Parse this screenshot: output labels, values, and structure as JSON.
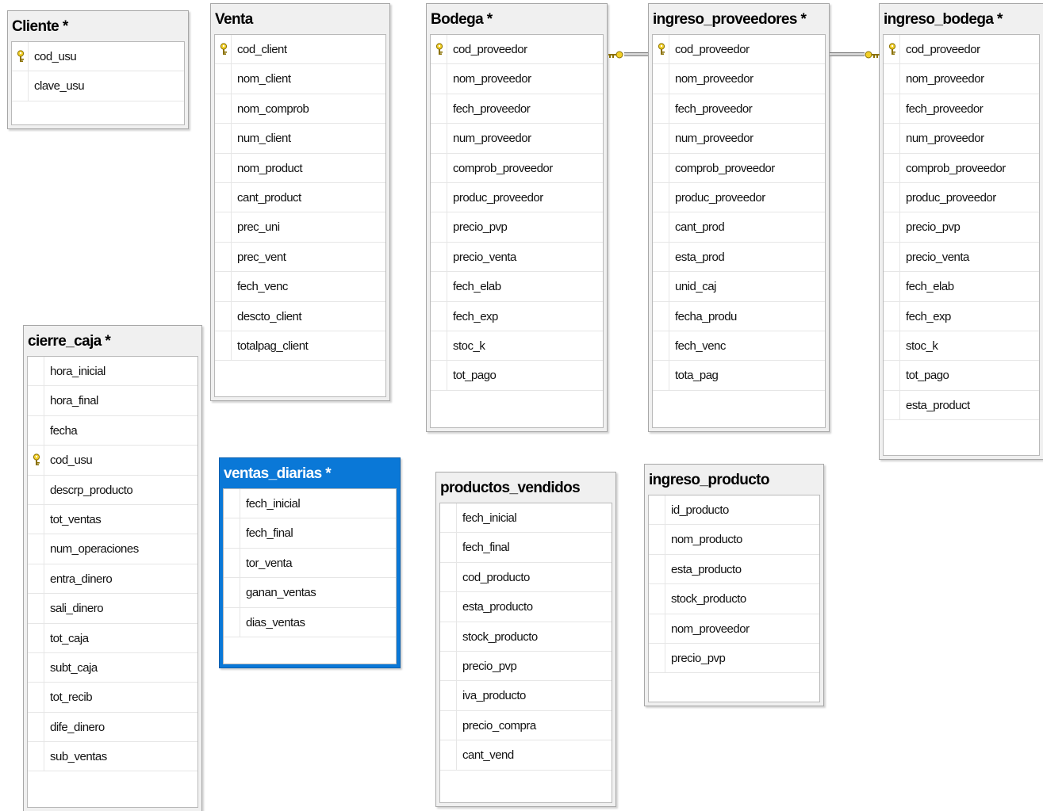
{
  "tables": {
    "cliente": {
      "title": "Cliente *",
      "columns": [
        {
          "name": "cod_usu",
          "pk": true
        },
        {
          "name": "clave_usu",
          "pk": false
        }
      ]
    },
    "venta": {
      "title": "Venta",
      "columns": [
        {
          "name": "cod_client",
          "pk": true
        },
        {
          "name": "nom_client",
          "pk": false
        },
        {
          "name": "nom_comprob",
          "pk": false
        },
        {
          "name": "num_client",
          "pk": false
        },
        {
          "name": "nom_product",
          "pk": false
        },
        {
          "name": "cant_product",
          "pk": false
        },
        {
          "name": "prec_uni",
          "pk": false
        },
        {
          "name": "prec_vent",
          "pk": false
        },
        {
          "name": "fech_venc",
          "pk": false
        },
        {
          "name": "descto_client",
          "pk": false
        },
        {
          "name": "totalpag_client",
          "pk": false
        }
      ]
    },
    "bodega": {
      "title": "Bodega *",
      "columns": [
        {
          "name": "cod_proveedor",
          "pk": true
        },
        {
          "name": "nom_proveedor",
          "pk": false
        },
        {
          "name": "fech_proveedor",
          "pk": false
        },
        {
          "name": "num_proveedor",
          "pk": false
        },
        {
          "name": "comprob_proveedor",
          "pk": false
        },
        {
          "name": "produc_proveedor",
          "pk": false
        },
        {
          "name": "precio_pvp",
          "pk": false
        },
        {
          "name": "precio_venta",
          "pk": false
        },
        {
          "name": "fech_elab",
          "pk": false
        },
        {
          "name": "fech_exp",
          "pk": false
        },
        {
          "name": "stoc_k",
          "pk": false
        },
        {
          "name": "tot_pago",
          "pk": false
        }
      ]
    },
    "ingreso_proveedores": {
      "title": "ingreso_proveedores *",
      "columns": [
        {
          "name": "cod_proveedor",
          "pk": true
        },
        {
          "name": "nom_proveedor",
          "pk": false
        },
        {
          "name": "fech_proveedor",
          "pk": false
        },
        {
          "name": "num_proveedor",
          "pk": false
        },
        {
          "name": "comprob_proveedor",
          "pk": false
        },
        {
          "name": "produc_proveedor",
          "pk": false
        },
        {
          "name": "cant_prod",
          "pk": false
        },
        {
          "name": "esta_prod",
          "pk": false
        },
        {
          "name": "unid_caj",
          "pk": false
        },
        {
          "name": "fecha_produ",
          "pk": false
        },
        {
          "name": "fech_venc",
          "pk": false
        },
        {
          "name": "tota_pag",
          "pk": false
        }
      ]
    },
    "ingreso_bodega": {
      "title": "ingreso_bodega *",
      "columns": [
        {
          "name": "cod_proveedor",
          "pk": true
        },
        {
          "name": "nom_proveedor",
          "pk": false
        },
        {
          "name": "fech_proveedor",
          "pk": false
        },
        {
          "name": "num_proveedor",
          "pk": false
        },
        {
          "name": "comprob_proveedor",
          "pk": false
        },
        {
          "name": "produc_proveedor",
          "pk": false
        },
        {
          "name": "precio_pvp",
          "pk": false
        },
        {
          "name": "precio_venta",
          "pk": false
        },
        {
          "name": "fech_elab",
          "pk": false
        },
        {
          "name": "fech_exp",
          "pk": false
        },
        {
          "name": "stoc_k",
          "pk": false
        },
        {
          "name": "tot_pago",
          "pk": false
        },
        {
          "name": "esta_product",
          "pk": false
        }
      ]
    },
    "cierre_caja": {
      "title": "cierre_caja *",
      "columns": [
        {
          "name": "hora_inicial",
          "pk": false
        },
        {
          "name": "hora_final",
          "pk": false
        },
        {
          "name": "fecha",
          "pk": false
        },
        {
          "name": "cod_usu",
          "pk": true
        },
        {
          "name": "descrp_producto",
          "pk": false
        },
        {
          "name": "tot_ventas",
          "pk": false
        },
        {
          "name": "num_operaciones",
          "pk": false
        },
        {
          "name": "entra_dinero",
          "pk": false
        },
        {
          "name": "sali_dinero",
          "pk": false
        },
        {
          "name": "tot_caja",
          "pk": false
        },
        {
          "name": "subt_caja",
          "pk": false
        },
        {
          "name": "tot_recib",
          "pk": false
        },
        {
          "name": "dife_dinero",
          "pk": false
        },
        {
          "name": "sub_ventas",
          "pk": false
        }
      ]
    },
    "ventas_diarias": {
      "title": "ventas_diarias *",
      "selected": true,
      "columns": [
        {
          "name": "fech_inicial",
          "pk": false
        },
        {
          "name": "fech_final",
          "pk": false
        },
        {
          "name": "tor_venta",
          "pk": false
        },
        {
          "name": "ganan_ventas",
          "pk": false
        },
        {
          "name": "dias_ventas",
          "pk": false
        }
      ]
    },
    "productos_vendidos": {
      "title": "productos_vendidos",
      "columns": [
        {
          "name": "fech_inicial",
          "pk": false
        },
        {
          "name": "fech_final",
          "pk": false
        },
        {
          "name": "cod_producto",
          "pk": false
        },
        {
          "name": "esta_producto",
          "pk": false
        },
        {
          "name": "stock_producto",
          "pk": false
        },
        {
          "name": "precio_pvp",
          "pk": false
        },
        {
          "name": "iva_producto",
          "pk": false
        },
        {
          "name": "precio_compra",
          "pk": false
        },
        {
          "name": "cant_vend",
          "pk": false
        }
      ]
    },
    "ingreso_producto": {
      "title": "ingreso_producto",
      "columns": [
        {
          "name": "id_producto",
          "pk": false
        },
        {
          "name": "nom_producto",
          "pk": false
        },
        {
          "name": "esta_producto",
          "pk": false
        },
        {
          "name": "stock_producto",
          "pk": false
        },
        {
          "name": "nom_proveedor",
          "pk": false
        },
        {
          "name": "precio_pvp",
          "pk": false
        }
      ]
    }
  },
  "relationships": [
    {
      "from": "bodega",
      "to": "ingreso_proveedores"
    },
    {
      "from": "ingreso_proveedores",
      "to": "ingreso_bodega"
    }
  ],
  "colors": {
    "key_icon": "#e0b800",
    "selected_header": "#0a78d7"
  }
}
